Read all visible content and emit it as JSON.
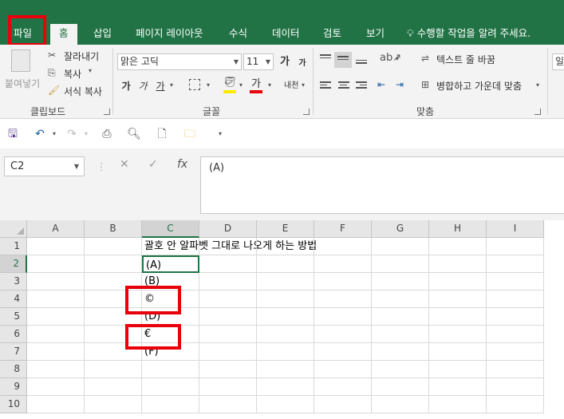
{
  "tabs": [
    {
      "label": "파일",
      "active": false
    },
    {
      "label": "홈",
      "active": true
    },
    {
      "label": "삽입",
      "active": false
    },
    {
      "label": "페이지 레이아웃",
      "active": false
    },
    {
      "label": "수식",
      "active": false
    },
    {
      "label": "데이터",
      "active": false
    },
    {
      "label": "검토",
      "active": false
    },
    {
      "label": "보기",
      "active": false
    }
  ],
  "tell_me": "수행할 작업을 알려 주세요.",
  "ribbon": {
    "clipboard": {
      "paste": "붙여넣기",
      "cut": "잘라내기",
      "copy": "복사",
      "format_painter": "서식 복사",
      "group_label": "클립보드"
    },
    "font": {
      "font_name": "맑은 고딕",
      "font_size": "11",
      "grow": "가",
      "shrink": "가",
      "bold": "가",
      "italic": "가",
      "underline": "가",
      "font_color": "가",
      "phonetic": "내천",
      "group_label": "글꼴"
    },
    "alignment": {
      "wrap_text": "텍스트 줄 바꿈",
      "merge_center": "병합하고 가운데 맞춤",
      "group_label": "맞춤"
    },
    "number": {
      "format": "일"
    }
  },
  "formula_bar": {
    "name_box": "C2",
    "cancel": "✕",
    "enter": "✓",
    "fx": "fx",
    "content": "(A)"
  },
  "grid": {
    "columns": [
      "A",
      "B",
      "C",
      "D",
      "E",
      "F",
      "G",
      "H",
      "I"
    ],
    "rows": [
      "1",
      "2",
      "3",
      "4",
      "5",
      "6",
      "7",
      "8",
      "9",
      "10"
    ],
    "selected_cell": "C2",
    "cells": {
      "C1": "괄호 안 알파벳 그대로 나오게 하는 방법",
      "C2": "(A)",
      "C3": "(B)",
      "C4": "©",
      "C5": "(D)",
      "C6": "€",
      "C7": "(F)"
    }
  },
  "colors": {
    "accent": "#217346",
    "highlight_box": "#e8000b"
  }
}
